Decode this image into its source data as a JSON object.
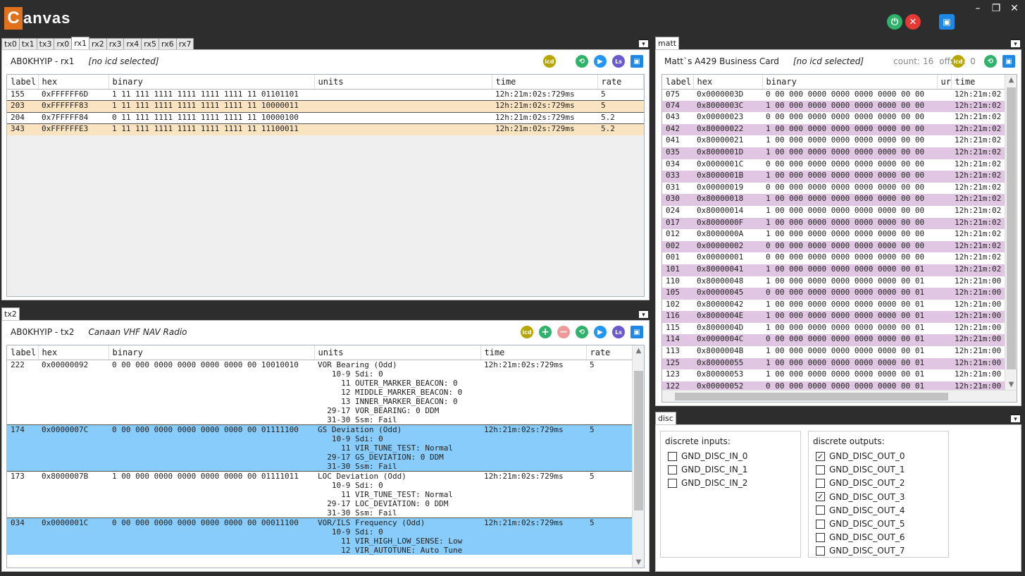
{
  "app": {
    "logo_c": "C",
    "logo_rest": "anvas"
  },
  "window_controls": {
    "minimize": "–",
    "restore": "❐",
    "close": "✕"
  },
  "top_tabs": [
    "tx0",
    "tx1",
    "tx3",
    "rx0",
    "rx1",
    "rx2",
    "rx3",
    "rx4",
    "rx5",
    "rx6",
    "rx7"
  ],
  "rx1_panel": {
    "title": "AB0KHYIP - rx1",
    "icd": "[no icd selected]",
    "columns": [
      "label",
      "hex",
      "binary",
      "units",
      "time",
      "rate"
    ],
    "rows": [
      {
        "label": "155",
        "hex": "0xFFFFFF6D",
        "binary": "1 11 111 1111 1111 1111 1111 11 01101101",
        "units": "",
        "time": "12h:21m:02s:729ms",
        "rate": "5",
        "style": "white"
      },
      {
        "label": "203",
        "hex": "0xFFFFFF83",
        "binary": "1 11 111 1111 1111 1111 1111 11 10000011",
        "units": "",
        "time": "12h:21m:02s:729ms",
        "rate": "5",
        "style": "tan"
      },
      {
        "label": "204",
        "hex": "0x7FFFFF84",
        "binary": "0 11 111 1111 1111 1111 1111 11 10000100",
        "units": "",
        "time": "12h:21m:02s:729ms",
        "rate": "5.2",
        "style": "white"
      },
      {
        "label": "343",
        "hex": "0xFFFFFFE3",
        "binary": "1 11 111 1111 1111 1111 1111 11 11100011",
        "units": "",
        "time": "12h:21m:02s:729ms",
        "rate": "5.2",
        "style": "tan"
      }
    ]
  },
  "tx2_panel": {
    "tab": "tx2",
    "title": "AB0KHYIP - tx2",
    "icd": "Canaan VHF NAV Radio",
    "columns": [
      "label",
      "hex",
      "binary",
      "units",
      "time",
      "rate"
    ],
    "rows": [
      {
        "label": "222",
        "hex": "0x00000092",
        "binary": "0 00 000 0000 0000 0000 0000 00 10010010",
        "units": "VOR Bearing (Odd)\n   10-9 Sdi: 0\n     11 OUTER_MARKER_BEACON: 0\n     12 MIDDLE_MARKER_BEACON: 0\n     13 INNER_MARKER_BEACON: 0\n  29-17 VOR_BEARING: 0 DDM\n  31-30 Ssm: Fail",
        "time": "12h:21m:02s:729ms",
        "rate": "5",
        "style": "white"
      },
      {
        "label": "174",
        "hex": "0x0000007C",
        "binary": "0 00 000 0000 0000 0000 0000 00 01111100",
        "units": "GS Deviation (Odd)\n   10-9 Sdi: 0\n     11 VIR_TUNE_TEST: Normal\n  29-17 GS_DEVIATION: 0 DDM\n  31-30 Ssm: Fail",
        "time": "12h:21m:02s:729ms",
        "rate": "5",
        "style": "blue"
      },
      {
        "label": "173",
        "hex": "0x8000007B",
        "binary": "1 00 000 0000 0000 0000 0000 00 01111011",
        "units": "LOC Deviation (Odd)\n   10-9 Sdi: 0\n     11 VIR_TUNE_TEST: Normal\n  29-17 LOC_DEVIATION: 0 DDM\n  31-30 Ssm: Fail",
        "time": "12h:21m:02s:729ms",
        "rate": "5",
        "style": "white"
      },
      {
        "label": "034",
        "hex": "0x0000001C",
        "binary": "0 00 000 0000 0000 0000 0000 00 00011100",
        "units": "VOR/ILS Frequency (Odd)\n   10-9 Sdi: 0\n     11 VIR_HIGH_LOW_SENSE: Low\n     12 VIR_AUTOTUNE: Auto Tune",
        "time": "12h:21m:02s:729ms",
        "rate": "5",
        "style": "blue"
      }
    ]
  },
  "matt_panel": {
    "tab": "matt",
    "title": "Matt`s A429 Business Card",
    "icd": "[no icd selected]",
    "count_label": "count:",
    "count": "16",
    "offset_label": "offset:",
    "offset": "0",
    "columns": [
      "label",
      "hex",
      "binary",
      "ur",
      "time"
    ],
    "rows": [
      {
        "label": "075",
        "hex": "0x0000003D",
        "binary": "0 00 000 0000 0000 0000 0000 00 00",
        "time": "12h:21m:02",
        "style": "white"
      },
      {
        "label": "074",
        "hex": "0x8000003C",
        "binary": "1 00 000 0000 0000 0000 0000 00 00",
        "time": "12h:21m:02",
        "style": "purple"
      },
      {
        "label": "043",
        "hex": "0x00000023",
        "binary": "0 00 000 0000 0000 0000 0000 00 00",
        "time": "12h:21m:02",
        "style": "white"
      },
      {
        "label": "042",
        "hex": "0x80000022",
        "binary": "1 00 000 0000 0000 0000 0000 00 00",
        "time": "12h:21m:02",
        "style": "purple"
      },
      {
        "label": "041",
        "hex": "0x80000021",
        "binary": "1 00 000 0000 0000 0000 0000 00 00",
        "time": "12h:21m:02",
        "style": "white"
      },
      {
        "label": "035",
        "hex": "0x8000001D",
        "binary": "1 00 000 0000 0000 0000 0000 00 00",
        "time": "12h:21m:02",
        "style": "purple"
      },
      {
        "label": "034",
        "hex": "0x0000001C",
        "binary": "0 00 000 0000 0000 0000 0000 00 00",
        "time": "12h:21m:02",
        "style": "white"
      },
      {
        "label": "033",
        "hex": "0x8000001B",
        "binary": "1 00 000 0000 0000 0000 0000 00 00",
        "time": "12h:21m:02",
        "style": "purple"
      },
      {
        "label": "031",
        "hex": "0x00000019",
        "binary": "0 00 000 0000 0000 0000 0000 00 00",
        "time": "12h:21m:02",
        "style": "white"
      },
      {
        "label": "030",
        "hex": "0x80000018",
        "binary": "1 00 000 0000 0000 0000 0000 00 00",
        "time": "12h:21m:02",
        "style": "purple"
      },
      {
        "label": "024",
        "hex": "0x80000014",
        "binary": "1 00 000 0000 0000 0000 0000 00 00",
        "time": "12h:21m:02",
        "style": "white"
      },
      {
        "label": "017",
        "hex": "0x8000000F",
        "binary": "1 00 000 0000 0000 0000 0000 00 00",
        "time": "12h:21m:02",
        "style": "purple"
      },
      {
        "label": "012",
        "hex": "0x8000000A",
        "binary": "1 00 000 0000 0000 0000 0000 00 00",
        "time": "12h:21m:02",
        "style": "white"
      },
      {
        "label": "002",
        "hex": "0x00000002",
        "binary": "0 00 000 0000 0000 0000 0000 00 00",
        "time": "12h:21m:02",
        "style": "purple"
      },
      {
        "label": "001",
        "hex": "0x00000001",
        "binary": "0 00 000 0000 0000 0000 0000 00 00",
        "time": "12h:21m:02",
        "style": "white"
      },
      {
        "label": "101",
        "hex": "0x80000041",
        "binary": "1 00 000 0000 0000 0000 0000 00 01",
        "time": "12h:21m:02",
        "style": "purple"
      },
      {
        "label": "110",
        "hex": "0x80000048",
        "binary": "1 00 000 0000 0000 0000 0000 00 01",
        "time": "12h:21m:00",
        "style": "white"
      },
      {
        "label": "105",
        "hex": "0x00000045",
        "binary": "0 00 000 0000 0000 0000 0000 00 01",
        "time": "12h:21m:00",
        "style": "purple"
      },
      {
        "label": "102",
        "hex": "0x80000042",
        "binary": "1 00 000 0000 0000 0000 0000 00 01",
        "time": "12h:21m:00",
        "style": "white"
      },
      {
        "label": "116",
        "hex": "0x8000004E",
        "binary": "1 00 000 0000 0000 0000 0000 00 01",
        "time": "12h:21m:00",
        "style": "purple"
      },
      {
        "label": "115",
        "hex": "0x8000004D",
        "binary": "1 00 000 0000 0000 0000 0000 00 01",
        "time": "12h:21m:00",
        "style": "white"
      },
      {
        "label": "114",
        "hex": "0x0000004C",
        "binary": "0 00 000 0000 0000 0000 0000 00 01",
        "time": "12h:21m:00",
        "style": "purple"
      },
      {
        "label": "113",
        "hex": "0x8000004B",
        "binary": "1 00 000 0000 0000 0000 0000 00 01",
        "time": "12h:21m:00",
        "style": "white"
      },
      {
        "label": "125",
        "hex": "0x80000055",
        "binary": "1 00 000 0000 0000 0000 0000 00 01",
        "time": "12h:21m:00",
        "style": "purple"
      },
      {
        "label": "123",
        "hex": "0x80000053",
        "binary": "1 00 000 0000 0000 0000 0000 00 01",
        "time": "12h:21m:00",
        "style": "white"
      },
      {
        "label": "122",
        "hex": "0x00000052",
        "binary": "0 00 000 0000 0000 0000 0000 00 01",
        "time": "12h:21m:00",
        "style": "purple"
      }
    ]
  },
  "disc_panel": {
    "tab": "disc",
    "inputs_title": "discrete inputs:",
    "outputs_title": "discrete outputs:",
    "inputs": [
      {
        "name": "GND_DISC_IN_0",
        "checked": false
      },
      {
        "name": "GND_DISC_IN_1",
        "checked": false
      },
      {
        "name": "GND_DISC_IN_2",
        "checked": false
      }
    ],
    "outputs": [
      {
        "name": "GND_DISC_OUT_0",
        "checked": true
      },
      {
        "name": "GND_DISC_OUT_1",
        "checked": false
      },
      {
        "name": "GND_DISC_OUT_2",
        "checked": false
      },
      {
        "name": "GND_DISC_OUT_3",
        "checked": true
      },
      {
        "name": "GND_DISC_OUT_4",
        "checked": false
      },
      {
        "name": "GND_DISC_OUT_5",
        "checked": false
      },
      {
        "name": "GND_DISC_OUT_6",
        "checked": false
      },
      {
        "name": "GND_DISC_OUT_7",
        "checked": false
      }
    ]
  },
  "icons": {
    "icd": "icd",
    "ls": "Ls",
    "replay": "⟲",
    "play": "▶",
    "add": "+",
    "remove": "−",
    "save": "💾",
    "dropdown": "▾",
    "check": "✓",
    "scroll_up": "▲",
    "scroll_down": "▼"
  },
  "colors": {
    "tan_row": "#fae3c0",
    "purple_row": "#e0c6e2",
    "blue_row": "#87ccfa",
    "logo": "#e2711d"
  }
}
